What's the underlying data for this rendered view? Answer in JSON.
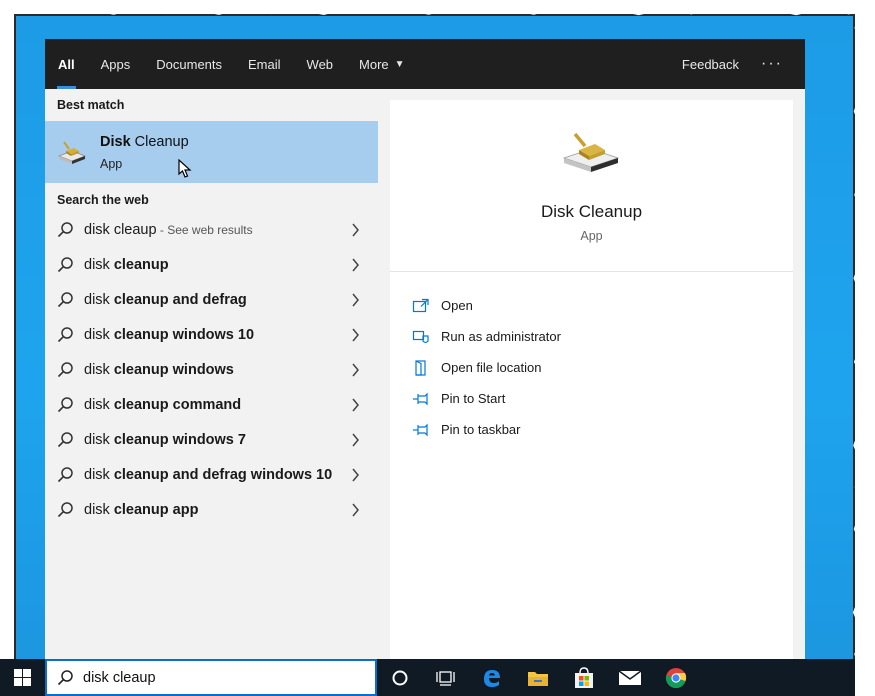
{
  "tabs": [
    {
      "label": "All"
    },
    {
      "label": "Apps"
    },
    {
      "label": "Documents"
    },
    {
      "label": "Email"
    },
    {
      "label": "Web"
    },
    {
      "label": "More"
    }
  ],
  "header": {
    "feedback": "Feedback",
    "more_options": "···"
  },
  "best_match": {
    "section_label": "Best match",
    "title_bold": "Disk",
    "title_rest": " Cleanup",
    "subtitle": "App",
    "icon": "disk-cleanup-icon"
  },
  "web": {
    "section_label": "Search the web",
    "results": [
      {
        "prefix": "disk cleaup",
        "bold": "",
        "suffix": " - See web results"
      },
      {
        "prefix": "disk ",
        "bold": "cleanup",
        "suffix": ""
      },
      {
        "prefix": "disk ",
        "bold": "cleanup and defrag",
        "suffix": ""
      },
      {
        "prefix": "disk ",
        "bold": "cleanup windows 10",
        "suffix": ""
      },
      {
        "prefix": "disk ",
        "bold": "cleanup windows",
        "suffix": ""
      },
      {
        "prefix": "disk ",
        "bold": "cleanup command",
        "suffix": ""
      },
      {
        "prefix": "disk ",
        "bold": "cleanup windows 7",
        "suffix": ""
      },
      {
        "prefix": "disk ",
        "bold": "cleanup and defrag windows 10",
        "suffix": ""
      },
      {
        "prefix": "disk ",
        "bold": "cleanup app",
        "suffix": ""
      }
    ]
  },
  "preview": {
    "title": "Disk Cleanup",
    "subtitle": "App",
    "actions": [
      {
        "label": "Open",
        "icon": "open-icon"
      },
      {
        "label": "Run as administrator",
        "icon": "shield-icon"
      },
      {
        "label": "Open file location",
        "icon": "file-location-icon"
      },
      {
        "label": "Pin to Start",
        "icon": "pin-icon"
      },
      {
        "label": "Pin to taskbar",
        "icon": "pin-icon"
      }
    ]
  },
  "search": {
    "value": "disk cleaup"
  },
  "taskbar": {
    "icons": [
      "windows-start-icon",
      "cortana-icon",
      "task-view-icon",
      "edge-icon",
      "file-explorer-icon",
      "store-icon",
      "mail-icon",
      "chrome-icon"
    ]
  },
  "colors": {
    "accent": "#3b8ede",
    "selected": "#a7cdee",
    "desktop": "#1ea4ee",
    "topbar": "#1f1f1f",
    "taskbar": "#0f1a24",
    "action_icon": "#0078d7"
  }
}
